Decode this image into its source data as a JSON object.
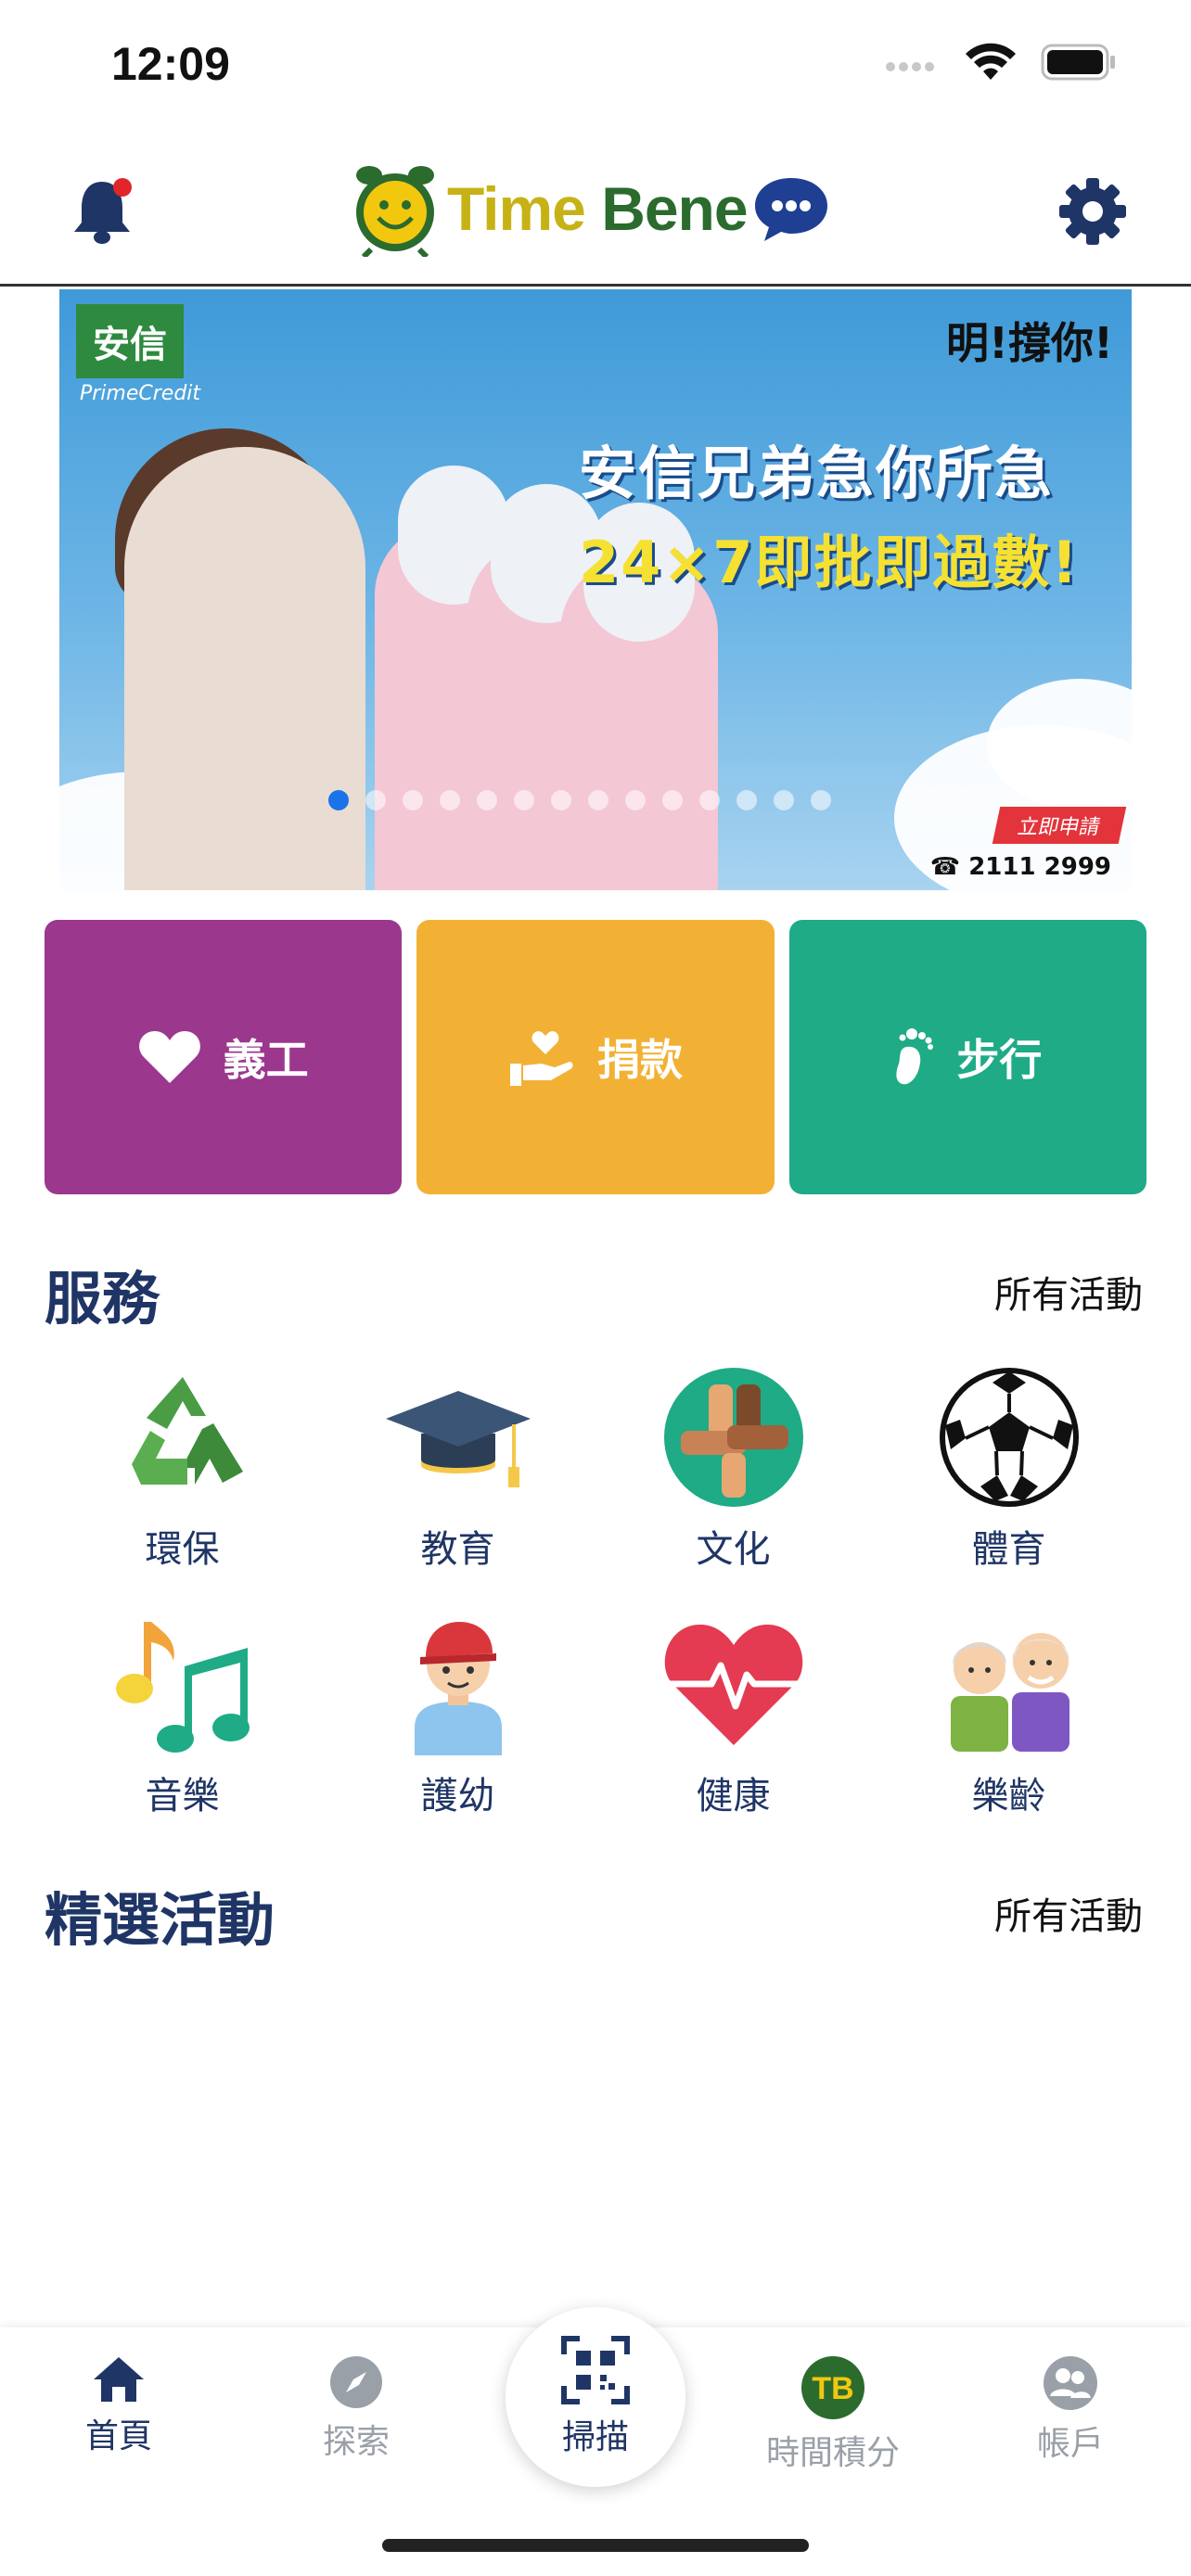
{
  "status": {
    "time": "12:09"
  },
  "header": {
    "logo_part1": "Time ",
    "logo_part2": "Bene"
  },
  "banner": {
    "brand_cn": "安信",
    "brand_en": "PrimeCredit",
    "top_right": "明!撐你!",
    "slogan_line1": "安信兄弟急你所急",
    "slogan_line2": "24×7即批即過數!",
    "cta": "立即申請",
    "phone": "2111 2999",
    "slide_count": 14,
    "active_slide": 1
  },
  "actions": [
    {
      "label": "義工",
      "icon": "heart-icon",
      "color": "#9b378d"
    },
    {
      "label": "捐款",
      "icon": "donate-hand-icon",
      "color": "#f2b134"
    },
    {
      "label": "步行",
      "icon": "footprint-icon",
      "color": "#1eab86"
    }
  ],
  "services": {
    "title": "服務",
    "link": "所有活動",
    "items": [
      {
        "label": "環保",
        "icon": "recycle-icon"
      },
      {
        "label": "教育",
        "icon": "graduation-cap-icon"
      },
      {
        "label": "文化",
        "icon": "hands-culture-icon"
      },
      {
        "label": "體育",
        "icon": "soccer-ball-icon"
      },
      {
        "label": "音樂",
        "icon": "music-notes-icon"
      },
      {
        "label": "護幼",
        "icon": "child-icon"
      },
      {
        "label": "健康",
        "icon": "heartbeat-icon"
      },
      {
        "label": "樂齡",
        "icon": "elderly-couple-icon"
      }
    ]
  },
  "featured": {
    "title": "精選活動",
    "link": "所有活動"
  },
  "tabbar": {
    "home": "首頁",
    "explore": "探索",
    "scan": "掃描",
    "points": "時間積分",
    "points_badge": "TB",
    "account": "帳戶"
  },
  "colors": {
    "primary": "#1f3566",
    "inactive": "#9aa0a8",
    "notification": "#e0262b"
  }
}
